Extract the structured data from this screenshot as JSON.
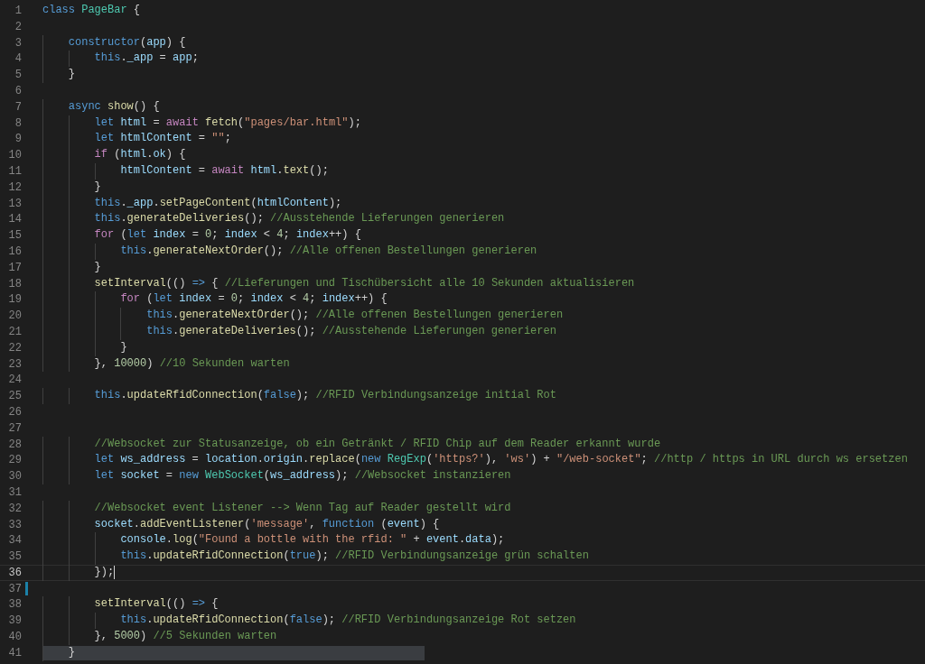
{
  "editor": {
    "lines": [
      {
        "number": "1",
        "current": false,
        "modified": false,
        "highlighted": false,
        "tokens": [
          {
            "kind": "keyword",
            "text": "class "
          },
          {
            "kind": "type",
            "text": "PageBar"
          },
          {
            "kind": "plain",
            "text": " {"
          }
        ]
      },
      {
        "number": "2",
        "current": false,
        "modified": false,
        "highlighted": false
      },
      {
        "number": "3",
        "current": false,
        "modified": false,
        "highlighted": false,
        "tokens": [
          {
            "kind": "keyword",
            "text": "    constructor"
          },
          {
            "kind": "plain",
            "text": "("
          },
          {
            "kind": "variable",
            "text": "app"
          },
          {
            "kind": "plain",
            "text": ") {"
          }
        ]
      },
      {
        "number": "4",
        "current": false,
        "modified": false,
        "highlighted": false,
        "tokens": [
          {
            "kind": "keyword",
            "text": "        this"
          },
          {
            "kind": "plain",
            "text": "."
          },
          {
            "kind": "variable",
            "text": "_app"
          },
          {
            "kind": "plain",
            "text": " = "
          },
          {
            "kind": "variable",
            "text": "app"
          },
          {
            "kind": "plain",
            "text": ";"
          }
        ]
      },
      {
        "number": "5",
        "current": false,
        "modified": false,
        "highlighted": false,
        "tokens": [
          {
            "kind": "plain",
            "text": "    }"
          }
        ]
      },
      {
        "number": "6",
        "current": false,
        "modified": false,
        "highlighted": false
      },
      {
        "number": "7",
        "current": false,
        "modified": false,
        "highlighted": false,
        "tokens": [
          {
            "kind": "keyword",
            "text": "    async "
          },
          {
            "kind": "function",
            "text": "show"
          },
          {
            "kind": "plain",
            "text": "() {"
          }
        ]
      },
      {
        "number": "8",
        "current": false,
        "modified": false,
        "highlighted": false,
        "tokens": [
          {
            "kind": "keyword",
            "text": "        let "
          },
          {
            "kind": "variable",
            "text": "html"
          },
          {
            "kind": "plain",
            "text": " = "
          },
          {
            "kind": "control",
            "text": "await "
          },
          {
            "kind": "function",
            "text": "fetch"
          },
          {
            "kind": "plain",
            "text": "("
          },
          {
            "kind": "string",
            "text": "\"pages/bar.html\""
          },
          {
            "kind": "plain",
            "text": ");"
          }
        ]
      },
      {
        "number": "9",
        "current": false,
        "modified": false,
        "highlighted": false,
        "tokens": [
          {
            "kind": "keyword",
            "text": "        let "
          },
          {
            "kind": "variable",
            "text": "htmlContent"
          },
          {
            "kind": "plain",
            "text": " = "
          },
          {
            "kind": "string",
            "text": "\"\""
          },
          {
            "kind": "plain",
            "text": ";"
          }
        ]
      },
      {
        "number": "10",
        "current": false,
        "modified": false,
        "highlighted": false,
        "tokens": [
          {
            "kind": "control",
            "text": "        if"
          },
          {
            "kind": "plain",
            "text": " ("
          },
          {
            "kind": "variable",
            "text": "html"
          },
          {
            "kind": "plain",
            "text": "."
          },
          {
            "kind": "variable",
            "text": "ok"
          },
          {
            "kind": "plain",
            "text": ") {"
          }
        ]
      },
      {
        "number": "11",
        "current": false,
        "modified": false,
        "highlighted": false,
        "tokens": [
          {
            "kind": "variable",
            "text": "            htmlContent"
          },
          {
            "kind": "plain",
            "text": " = "
          },
          {
            "kind": "control",
            "text": "await "
          },
          {
            "kind": "variable",
            "text": "html"
          },
          {
            "kind": "plain",
            "text": "."
          },
          {
            "kind": "function",
            "text": "text"
          },
          {
            "kind": "plain",
            "text": "();"
          }
        ]
      },
      {
        "number": "12",
        "current": false,
        "modified": false,
        "highlighted": false,
        "tokens": [
          {
            "kind": "plain",
            "text": "        }"
          }
        ]
      },
      {
        "number": "13",
        "current": false,
        "modified": false,
        "highlighted": false,
        "tokens": [
          {
            "kind": "keyword",
            "text": "        this"
          },
          {
            "kind": "plain",
            "text": "."
          },
          {
            "kind": "variable",
            "text": "_app"
          },
          {
            "kind": "plain",
            "text": "."
          },
          {
            "kind": "function",
            "text": "setPageContent"
          },
          {
            "kind": "plain",
            "text": "("
          },
          {
            "kind": "variable",
            "text": "htmlContent"
          },
          {
            "kind": "plain",
            "text": ");"
          }
        ]
      },
      {
        "number": "14",
        "current": false,
        "modified": false,
        "highlighted": false,
        "tokens": [
          {
            "kind": "keyword",
            "text": "        this"
          },
          {
            "kind": "plain",
            "text": "."
          },
          {
            "kind": "function",
            "text": "generateDeliveries"
          },
          {
            "kind": "plain",
            "text": "(); "
          },
          {
            "kind": "comment",
            "text": "//Ausstehende Lieferungen generieren"
          }
        ]
      },
      {
        "number": "15",
        "current": false,
        "modified": false,
        "highlighted": false,
        "tokens": [
          {
            "kind": "control",
            "text": "        for"
          },
          {
            "kind": "plain",
            "text": " ("
          },
          {
            "kind": "keyword",
            "text": "let "
          },
          {
            "kind": "variable",
            "text": "index"
          },
          {
            "kind": "plain",
            "text": " = "
          },
          {
            "kind": "number",
            "text": "0"
          },
          {
            "kind": "plain",
            "text": "; "
          },
          {
            "kind": "variable",
            "text": "index"
          },
          {
            "kind": "plain",
            "text": " < "
          },
          {
            "kind": "number",
            "text": "4"
          },
          {
            "kind": "plain",
            "text": "; "
          },
          {
            "kind": "variable",
            "text": "index"
          },
          {
            "kind": "plain",
            "text": "++) {"
          }
        ]
      },
      {
        "number": "16",
        "current": false,
        "modified": false,
        "highlighted": false,
        "tokens": [
          {
            "kind": "keyword",
            "text": "            this"
          },
          {
            "kind": "plain",
            "text": "."
          },
          {
            "kind": "function",
            "text": "generateNextOrder"
          },
          {
            "kind": "plain",
            "text": "(); "
          },
          {
            "kind": "comment",
            "text": "//Alle offenen Bestellungen generieren"
          }
        ]
      },
      {
        "number": "17",
        "current": false,
        "modified": false,
        "highlighted": false,
        "tokens": [
          {
            "kind": "plain",
            "text": "        }"
          }
        ]
      },
      {
        "number": "18",
        "current": false,
        "modified": false,
        "highlighted": false,
        "tokens": [
          {
            "kind": "function",
            "text": "        setInterval"
          },
          {
            "kind": "plain",
            "text": "(() "
          },
          {
            "kind": "keyword",
            "text": "=>"
          },
          {
            "kind": "plain",
            "text": " { "
          },
          {
            "kind": "comment",
            "text": "//Lieferungen und Tischübersicht alle 10 Sekunden aktualisieren"
          }
        ]
      },
      {
        "number": "19",
        "current": false,
        "modified": false,
        "highlighted": false,
        "tokens": [
          {
            "kind": "control",
            "text": "            for"
          },
          {
            "kind": "plain",
            "text": " ("
          },
          {
            "kind": "keyword",
            "text": "let "
          },
          {
            "kind": "variable",
            "text": "index"
          },
          {
            "kind": "plain",
            "text": " = "
          },
          {
            "kind": "number",
            "text": "0"
          },
          {
            "kind": "plain",
            "text": "; "
          },
          {
            "kind": "variable",
            "text": "index"
          },
          {
            "kind": "plain",
            "text": " < "
          },
          {
            "kind": "number",
            "text": "4"
          },
          {
            "kind": "plain",
            "text": "; "
          },
          {
            "kind": "variable",
            "text": "index"
          },
          {
            "kind": "plain",
            "text": "++) {"
          }
        ]
      },
      {
        "number": "20",
        "current": false,
        "modified": false,
        "highlighted": false,
        "tokens": [
          {
            "kind": "keyword",
            "text": "                this"
          },
          {
            "kind": "plain",
            "text": "."
          },
          {
            "kind": "function",
            "text": "generateNextOrder"
          },
          {
            "kind": "plain",
            "text": "(); "
          },
          {
            "kind": "comment",
            "text": "//Alle offenen Bestellungen generieren"
          }
        ]
      },
      {
        "number": "21",
        "current": false,
        "modified": false,
        "highlighted": false,
        "tokens": [
          {
            "kind": "keyword",
            "text": "                this"
          },
          {
            "kind": "plain",
            "text": "."
          },
          {
            "kind": "function",
            "text": "generateDeliveries"
          },
          {
            "kind": "plain",
            "text": "(); "
          },
          {
            "kind": "comment",
            "text": "//Ausstehende Lieferungen generieren"
          }
        ]
      },
      {
        "number": "22",
        "current": false,
        "modified": false,
        "highlighted": false,
        "tokens": [
          {
            "kind": "plain",
            "text": "            }"
          }
        ]
      },
      {
        "number": "23",
        "current": false,
        "modified": false,
        "highlighted": false,
        "tokens": [
          {
            "kind": "plain",
            "text": "        }, "
          },
          {
            "kind": "number",
            "text": "10000"
          },
          {
            "kind": "plain",
            "text": ") "
          },
          {
            "kind": "comment",
            "text": "//10 Sekunden warten"
          }
        ]
      },
      {
        "number": "24",
        "current": false,
        "modified": false,
        "highlighted": false
      },
      {
        "number": "25",
        "current": false,
        "modified": false,
        "highlighted": false,
        "tokens": [
          {
            "kind": "keyword",
            "text": "        this"
          },
          {
            "kind": "plain",
            "text": "."
          },
          {
            "kind": "function",
            "text": "updateRfidConnection"
          },
          {
            "kind": "plain",
            "text": "("
          },
          {
            "kind": "keyword",
            "text": "false"
          },
          {
            "kind": "plain",
            "text": "); "
          },
          {
            "kind": "comment",
            "text": "//RFID Verbindungsanzeige initial Rot"
          }
        ]
      },
      {
        "number": "26",
        "current": false,
        "modified": false,
        "highlighted": false
      },
      {
        "number": "27",
        "current": false,
        "modified": false,
        "highlighted": false
      },
      {
        "number": "28",
        "current": false,
        "modified": false,
        "highlighted": false,
        "tokens": [
          {
            "kind": "comment",
            "text": "        //Websocket zur Statusanzeige, ob ein Getränkt / RFID Chip auf dem Reader erkannt wurde"
          }
        ]
      },
      {
        "number": "29",
        "current": false,
        "modified": false,
        "highlighted": false,
        "tokens": [
          {
            "kind": "keyword",
            "text": "        let "
          },
          {
            "kind": "variable",
            "text": "ws_address"
          },
          {
            "kind": "plain",
            "text": " = "
          },
          {
            "kind": "variable",
            "text": "location"
          },
          {
            "kind": "plain",
            "text": "."
          },
          {
            "kind": "variable",
            "text": "origin"
          },
          {
            "kind": "plain",
            "text": "."
          },
          {
            "kind": "function",
            "text": "replace"
          },
          {
            "kind": "plain",
            "text": "("
          },
          {
            "kind": "keyword",
            "text": "new "
          },
          {
            "kind": "type",
            "text": "RegExp"
          },
          {
            "kind": "plain",
            "text": "("
          },
          {
            "kind": "string",
            "text": "'https?'"
          },
          {
            "kind": "plain",
            "text": "), "
          },
          {
            "kind": "string",
            "text": "'ws'"
          },
          {
            "kind": "plain",
            "text": ") + "
          },
          {
            "kind": "string",
            "text": "\"/web-socket\""
          },
          {
            "kind": "plain",
            "text": "; "
          },
          {
            "kind": "comment",
            "text": "//http / https in URL durch ws ersetzen"
          }
        ]
      },
      {
        "number": "30",
        "current": false,
        "modified": false,
        "highlighted": false,
        "tokens": [
          {
            "kind": "keyword",
            "text": "        let "
          },
          {
            "kind": "variable",
            "text": "socket"
          },
          {
            "kind": "plain",
            "text": " = "
          },
          {
            "kind": "keyword",
            "text": "new "
          },
          {
            "kind": "type",
            "text": "WebSocket"
          },
          {
            "kind": "plain",
            "text": "("
          },
          {
            "kind": "variable",
            "text": "ws_address"
          },
          {
            "kind": "plain",
            "text": "); "
          },
          {
            "kind": "comment",
            "text": "//Websocket instanzieren"
          }
        ]
      },
      {
        "number": "31",
        "current": false,
        "modified": false,
        "highlighted": false
      },
      {
        "number": "32",
        "current": false,
        "modified": false,
        "highlighted": false,
        "tokens": [
          {
            "kind": "comment",
            "text": "        //Websocket event Listener --> Wenn Tag auf Reader gestellt wird"
          }
        ]
      },
      {
        "number": "33",
        "current": false,
        "modified": false,
        "highlighted": false,
        "tokens": [
          {
            "kind": "variable",
            "text": "        socket"
          },
          {
            "kind": "plain",
            "text": "."
          },
          {
            "kind": "function",
            "text": "addEventListener"
          },
          {
            "kind": "plain",
            "text": "("
          },
          {
            "kind": "string",
            "text": "'message'"
          },
          {
            "kind": "plain",
            "text": ", "
          },
          {
            "kind": "keyword",
            "text": "function"
          },
          {
            "kind": "plain",
            "text": " ("
          },
          {
            "kind": "variable",
            "text": "event"
          },
          {
            "kind": "plain",
            "text": ") {"
          }
        ]
      },
      {
        "number": "34",
        "current": false,
        "modified": false,
        "highlighted": false,
        "tokens": [
          {
            "kind": "variable",
            "text": "            console"
          },
          {
            "kind": "plain",
            "text": "."
          },
          {
            "kind": "function",
            "text": "log"
          },
          {
            "kind": "plain",
            "text": "("
          },
          {
            "kind": "string",
            "text": "\"Found a bottle with the rfid: \""
          },
          {
            "kind": "plain",
            "text": " + "
          },
          {
            "kind": "variable",
            "text": "event"
          },
          {
            "kind": "plain",
            "text": "."
          },
          {
            "kind": "variable",
            "text": "data"
          },
          {
            "kind": "plain",
            "text": ");"
          }
        ]
      },
      {
        "number": "35",
        "current": false,
        "modified": false,
        "highlighted": false,
        "tokens": [
          {
            "kind": "keyword",
            "text": "            this"
          },
          {
            "kind": "plain",
            "text": "."
          },
          {
            "kind": "function",
            "text": "updateRfidConnection"
          },
          {
            "kind": "plain",
            "text": "("
          },
          {
            "kind": "keyword",
            "text": "true"
          },
          {
            "kind": "plain",
            "text": "); "
          },
          {
            "kind": "comment",
            "text": "//RFID Verbindungsanzeige grün schalten"
          }
        ]
      },
      {
        "number": "36",
        "current": true,
        "modified": false,
        "highlighted": false,
        "tokens": [
          {
            "kind": "plain",
            "text": "        });"
          }
        ]
      },
      {
        "number": "37",
        "current": false,
        "modified": true,
        "highlighted": false
      },
      {
        "number": "38",
        "current": false,
        "modified": false,
        "highlighted": false,
        "tokens": [
          {
            "kind": "function",
            "text": "        setInterval"
          },
          {
            "kind": "plain",
            "text": "(() "
          },
          {
            "kind": "keyword",
            "text": "=>"
          },
          {
            "kind": "plain",
            "text": " {"
          }
        ]
      },
      {
        "number": "39",
        "current": false,
        "modified": false,
        "highlighted": false,
        "tokens": [
          {
            "kind": "keyword",
            "text": "            this"
          },
          {
            "kind": "plain",
            "text": "."
          },
          {
            "kind": "function",
            "text": "updateRfidConnection"
          },
          {
            "kind": "plain",
            "text": "("
          },
          {
            "kind": "keyword",
            "text": "false"
          },
          {
            "kind": "plain",
            "text": "); "
          },
          {
            "kind": "comment",
            "text": "//RFID Verbindungsanzeige Rot setzen"
          }
        ]
      },
      {
        "number": "40",
        "current": false,
        "modified": false,
        "highlighted": false,
        "tokens": [
          {
            "kind": "plain",
            "text": "        }, "
          },
          {
            "kind": "number",
            "text": "5000"
          },
          {
            "kind": "plain",
            "text": ") "
          },
          {
            "kind": "comment",
            "text": "//5 Sekunden warten"
          }
        ]
      },
      {
        "number": "41",
        "current": false,
        "modified": false,
        "highlighted": true,
        "tokens": [
          {
            "kind": "plain",
            "text": "    }"
          }
        ]
      }
    ]
  }
}
